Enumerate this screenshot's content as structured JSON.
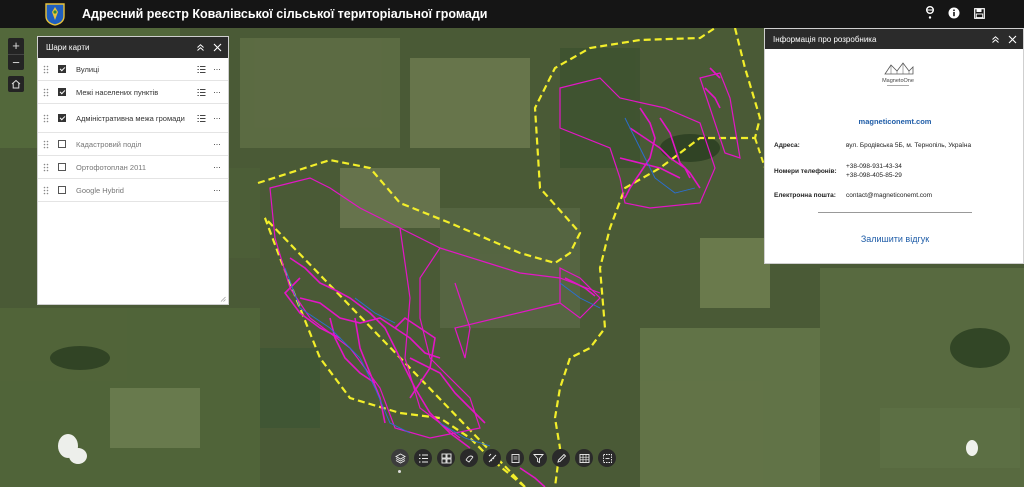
{
  "header": {
    "title": "Адресний реєстр Ковалівської сільської територіальної громади",
    "icons": [
      "coat-of-arms-logo",
      "user-icon",
      "info-icon",
      "save-icon"
    ]
  },
  "map_controls": {
    "zoom_in": "+",
    "zoom_out": "−",
    "home_icon": "home-icon"
  },
  "layers_panel": {
    "title": "Шари карти",
    "items": [
      {
        "label": "Вулиці",
        "checked": true
      },
      {
        "label": "Межі населених пунктів",
        "checked": true
      },
      {
        "label": "Адміністративна межа громади",
        "checked": true
      },
      {
        "label": "Кадастровий поділ",
        "checked": false
      },
      {
        "label": "Ортофотоплан 2011",
        "checked": false
      },
      {
        "label": "Google Hybrid",
        "checked": false
      }
    ],
    "more_label": "···"
  },
  "info_panel": {
    "title": "Інформація про розробника",
    "logo_text": "MagnetoOne",
    "website": "magneticonemt.com",
    "address_label": "Адреса:",
    "address_value": "вул. Бродівська 5Б, м. Тернопіль, Україна",
    "phones_label": "Номери телефонів:",
    "phone_1": "+38-098-931-43-34",
    "phone_2": "+38-098-405-85-29",
    "email_label": "Електронна пошта:",
    "email_value": "contact@magneticonemt.com",
    "feedback_label": "Залишити відгук"
  },
  "toolbar": {
    "tools": [
      "layers-icon",
      "list-icon",
      "basemap-gallery-icon",
      "bookmark-icon",
      "measure-icon",
      "print-icon",
      "filter-icon",
      "edit-icon",
      "table-icon",
      "select-icon"
    ]
  },
  "colors": {
    "header_bg": "#151515",
    "boundary": "#f2ee2a",
    "streets": "#e316c6",
    "settlement_edges": "#2a6fd6",
    "link": "#1f5da8"
  }
}
